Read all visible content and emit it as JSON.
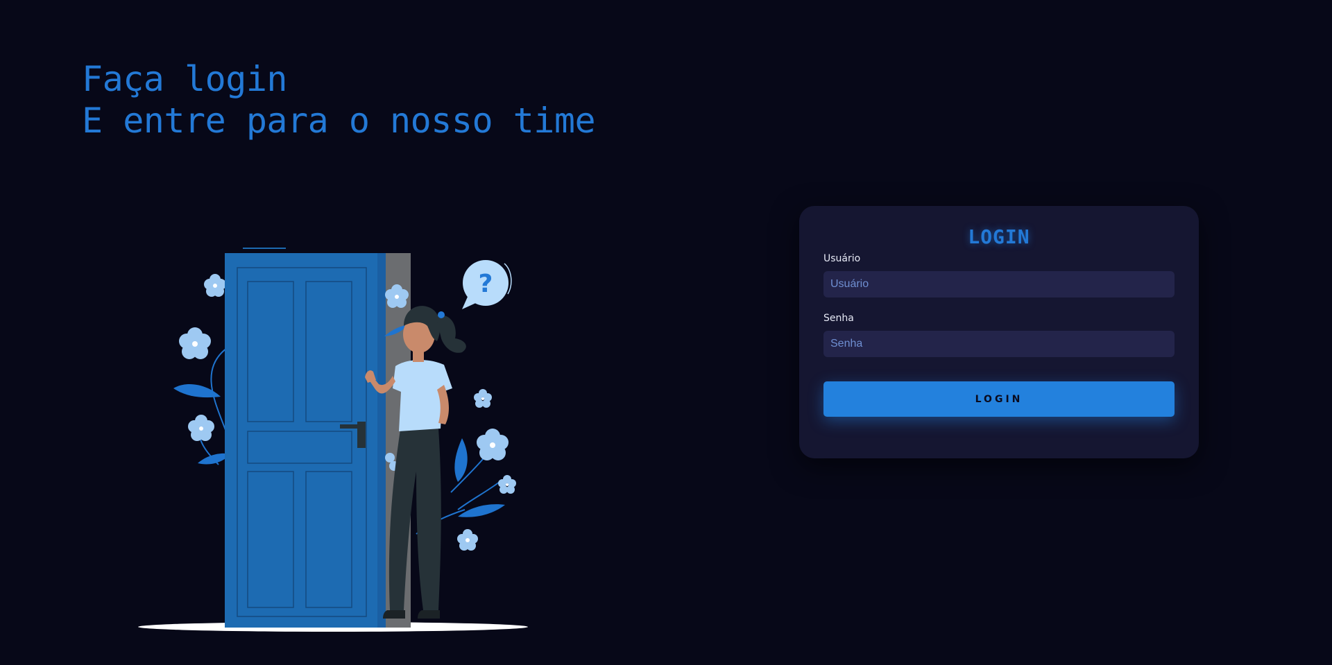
{
  "hero": {
    "line1": "Faça login",
    "line2": "E entre para o nosso time"
  },
  "illustration": {
    "description_icon": "woman-opening-door-illustration",
    "bubble_text": "?"
  },
  "login_card": {
    "title": "LOGIN",
    "username": {
      "label": "Usuário",
      "placeholder": "Usuário",
      "value": ""
    },
    "password": {
      "label": "Senha",
      "placeholder": "Senha",
      "value": ""
    },
    "submit_label": "LOGIN"
  },
  "colors": {
    "background": "#070818",
    "accent": "#2379d6",
    "card": "#151631",
    "input": "#23244a",
    "button": "#2381dd",
    "door": "#1d6bb2"
  }
}
